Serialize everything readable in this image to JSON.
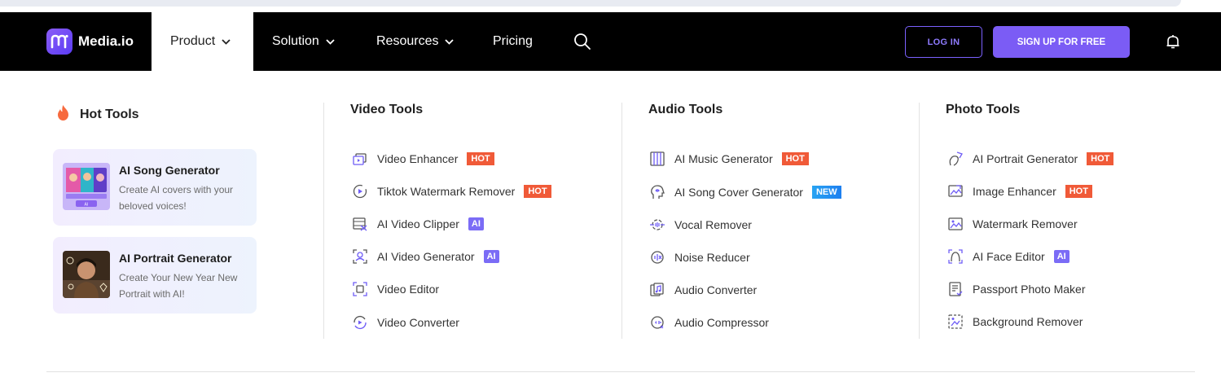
{
  "brand": {
    "name": "Media.io",
    "accent": "#7b5cf5",
    "hot_color": "#f05a38"
  },
  "nav": {
    "items": [
      {
        "label": "Product",
        "has_dropdown": true,
        "active": true
      },
      {
        "label": "Solution",
        "has_dropdown": true
      },
      {
        "label": "Resources",
        "has_dropdown": true
      },
      {
        "label": "Pricing",
        "has_dropdown": false
      }
    ],
    "login_label": "LOG IN",
    "signup_label": "SIGN UP FOR FREE",
    "icons": [
      "search-icon",
      "bell-icon"
    ]
  },
  "hot_tools": {
    "title": "Hot Tools",
    "cards": [
      {
        "title": "AI Song Generator",
        "desc": "Create AI covers with your beloved voices!"
      },
      {
        "title": "AI Portrait Generator",
        "desc": "Create Your New Year New Portrait with AI!"
      }
    ]
  },
  "columns": [
    {
      "title": "Video Tools",
      "items": [
        {
          "label": "Video Enhancer",
          "badge": "HOT",
          "icon": "video-enhancer-icon"
        },
        {
          "label": "Tiktok Watermark Remover",
          "badge": "HOT",
          "icon": "tiktok-icon"
        },
        {
          "label": "AI Video Clipper",
          "badge": "AI",
          "icon": "clipper-icon"
        },
        {
          "label": "AI Video Generator",
          "badge": "AI",
          "icon": "video-generator-icon"
        },
        {
          "label": "Video Editor",
          "badge": "",
          "icon": "video-editor-icon"
        },
        {
          "label": "Video Converter",
          "badge": "",
          "icon": "video-converter-icon"
        }
      ]
    },
    {
      "title": "Audio Tools",
      "items": [
        {
          "label": "AI Music Generator",
          "badge": "HOT",
          "icon": "music-generator-icon"
        },
        {
          "label": "AI Song Cover Generator",
          "badge": "NEW",
          "icon": "song-cover-icon"
        },
        {
          "label": "Vocal Remover",
          "badge": "",
          "icon": "vocal-remover-icon"
        },
        {
          "label": "Noise Reducer",
          "badge": "",
          "icon": "noise-reducer-icon"
        },
        {
          "label": "Audio Converter",
          "badge": "",
          "icon": "audio-converter-icon"
        },
        {
          "label": "Audio Compressor",
          "badge": "",
          "icon": "audio-compressor-icon"
        }
      ]
    },
    {
      "title": "Photo Tools",
      "items": [
        {
          "label": "AI Portrait Generator",
          "badge": "HOT",
          "icon": "portrait-icon"
        },
        {
          "label": "Image Enhancer",
          "badge": "HOT",
          "icon": "image-enhancer-icon"
        },
        {
          "label": "Watermark Remover",
          "badge": "",
          "icon": "watermark-remover-icon"
        },
        {
          "label": "AI Face Editor",
          "badge": "AI",
          "icon": "face-editor-icon"
        },
        {
          "label": "Passport Photo Maker",
          "badge": "",
          "icon": "passport-icon"
        },
        {
          "label": "Background Remover",
          "badge": "",
          "icon": "background-remover-icon"
        }
      ]
    }
  ]
}
